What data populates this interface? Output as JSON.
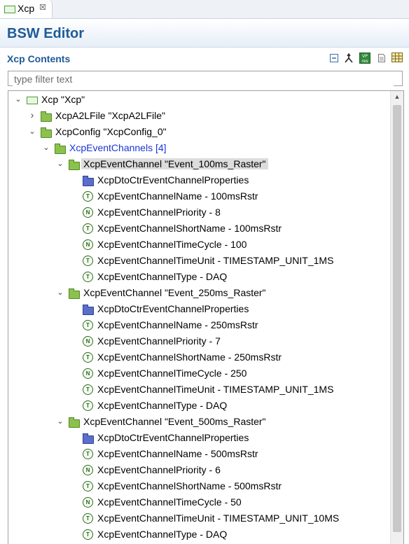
{
  "tab": {
    "label": "Xcp",
    "close": "☒"
  },
  "editor": {
    "title": "BSW Editor"
  },
  "section": {
    "title": "Xcp Contents"
  },
  "filter": {
    "placeholder": "type filter text"
  },
  "tree": [
    {
      "depth": 0,
      "expanded": true,
      "icon": "module",
      "label": "Xcp \"Xcp\""
    },
    {
      "depth": 1,
      "expanded": false,
      "icon": "folder",
      "label": "XcpA2LFile \"XcpA2LFile\""
    },
    {
      "depth": 1,
      "expanded": true,
      "icon": "folder",
      "label": "XcpConfig \"XcpConfig_0\""
    },
    {
      "depth": 2,
      "expanded": true,
      "icon": "folder",
      "label": "XcpEventChannels [4]",
      "blue": true
    },
    {
      "depth": 3,
      "expanded": true,
      "icon": "folder",
      "label": "XcpEventChannel \"Event_100ms_Raster\"",
      "selected": true
    },
    {
      "depth": 4,
      "icon": "blue-folder",
      "label": "XcpDtoCtrEventChannelProperties"
    },
    {
      "depth": 4,
      "icon": "param-T",
      "label": "XcpEventChannelName - 100msRstr"
    },
    {
      "depth": 4,
      "icon": "param-N",
      "label": "XcpEventChannelPriority - 8"
    },
    {
      "depth": 4,
      "icon": "param-T",
      "label": "XcpEventChannelShortName - 100msRstr"
    },
    {
      "depth": 4,
      "icon": "param-N",
      "label": "XcpEventChannelTimeCycle - 100"
    },
    {
      "depth": 4,
      "icon": "param-T",
      "label": "XcpEventChannelTimeUnit - TIMESTAMP_UNIT_1MS"
    },
    {
      "depth": 4,
      "icon": "param-T",
      "label": "XcpEventChannelType - DAQ"
    },
    {
      "depth": 3,
      "expanded": true,
      "icon": "folder",
      "label": "XcpEventChannel \"Event_250ms_Raster\""
    },
    {
      "depth": 4,
      "icon": "blue-folder",
      "label": "XcpDtoCtrEventChannelProperties"
    },
    {
      "depth": 4,
      "icon": "param-T",
      "label": "XcpEventChannelName - 250msRstr"
    },
    {
      "depth": 4,
      "icon": "param-N",
      "label": "XcpEventChannelPriority - 7"
    },
    {
      "depth": 4,
      "icon": "param-T",
      "label": "XcpEventChannelShortName - 250msRstr"
    },
    {
      "depth": 4,
      "icon": "param-N",
      "label": "XcpEventChannelTimeCycle - 250"
    },
    {
      "depth": 4,
      "icon": "param-T",
      "label": "XcpEventChannelTimeUnit - TIMESTAMP_UNIT_1MS"
    },
    {
      "depth": 4,
      "icon": "param-T",
      "label": "XcpEventChannelType - DAQ"
    },
    {
      "depth": 3,
      "expanded": true,
      "icon": "folder",
      "label": "XcpEventChannel \"Event_500ms_Raster\""
    },
    {
      "depth": 4,
      "icon": "blue-folder",
      "label": "XcpDtoCtrEventChannelProperties"
    },
    {
      "depth": 4,
      "icon": "param-T",
      "label": "XcpEventChannelName - 500msRstr"
    },
    {
      "depth": 4,
      "icon": "param-N",
      "label": "XcpEventChannelPriority - 6"
    },
    {
      "depth": 4,
      "icon": "param-T",
      "label": "XcpEventChannelShortName - 500msRstr"
    },
    {
      "depth": 4,
      "icon": "param-N",
      "label": "XcpEventChannelTimeCycle - 50"
    },
    {
      "depth": 4,
      "icon": "param-T",
      "label": "XcpEventChannelTimeUnit - TIMESTAMP_UNIT_10MS"
    },
    {
      "depth": 4,
      "icon": "param-T",
      "label": "XcpEventChannelType - DAQ"
    }
  ],
  "icons": {
    "param-T": "T",
    "param-N": "N",
    "toolbar_vp": "VP",
    "toolbar_res": "res"
  }
}
